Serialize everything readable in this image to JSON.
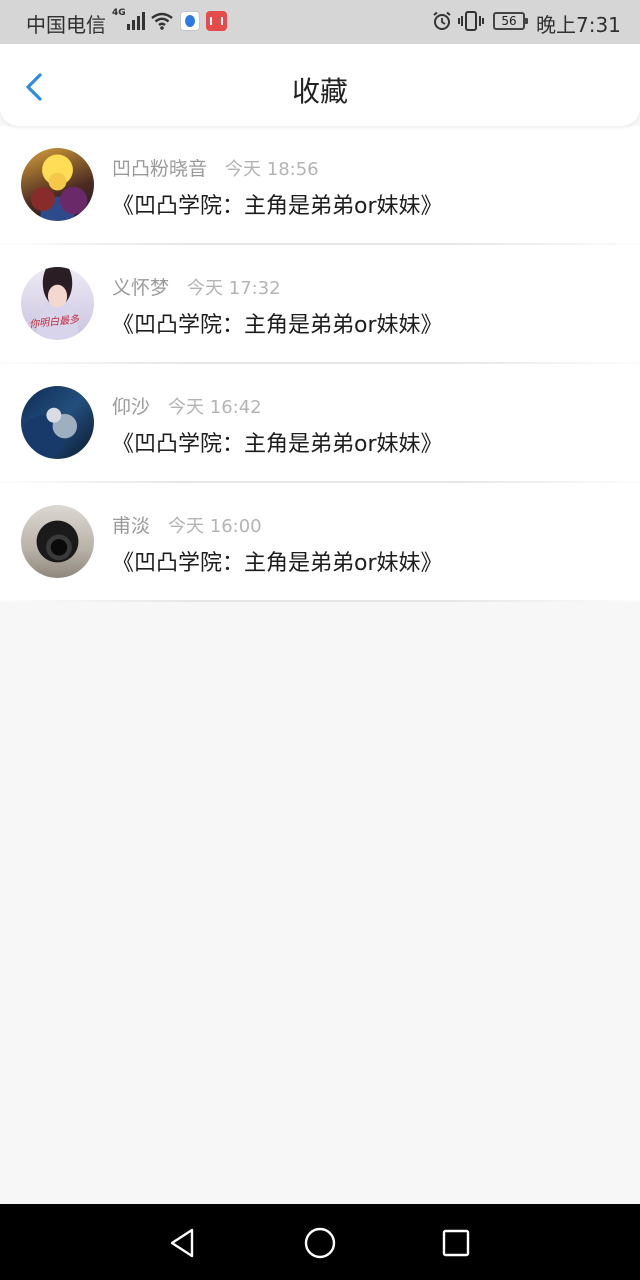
{
  "status_bar": {
    "carrier": "中国电信",
    "network_type": "4G",
    "battery_level": "56",
    "time": "晚上7:31",
    "icons": [
      "signal-icon",
      "wifi-icon",
      "baidu-app-icon",
      "huawei-mail-icon",
      "alarm-icon",
      "vibrate-icon",
      "battery-icon"
    ]
  },
  "header": {
    "title": "收藏",
    "back_icon": "chevron-left-icon",
    "accent_color": "#2b8ce8"
  },
  "favorites": [
    {
      "author": "凹凸粉晓音",
      "time": "今天 18:56",
      "title": "《凹凸学院：主角是弟弟or妹妹》"
    },
    {
      "author": "义怀梦",
      "time": "今天 17:32",
      "title": "《凹凸学院：主角是弟弟or妹妹》",
      "avatar_text": "你明白最多"
    },
    {
      "author": "仰沙",
      "time": "今天 16:42",
      "title": "《凹凸学院：主角是弟弟or妹妹》"
    },
    {
      "author": "甫淡",
      "time": "今天 16:00",
      "title": "《凹凸学院：主角是弟弟or妹妹》"
    }
  ],
  "nav_bar": {
    "icons": [
      "triangle-back-icon",
      "circle-home-icon",
      "square-recents-icon"
    ]
  }
}
